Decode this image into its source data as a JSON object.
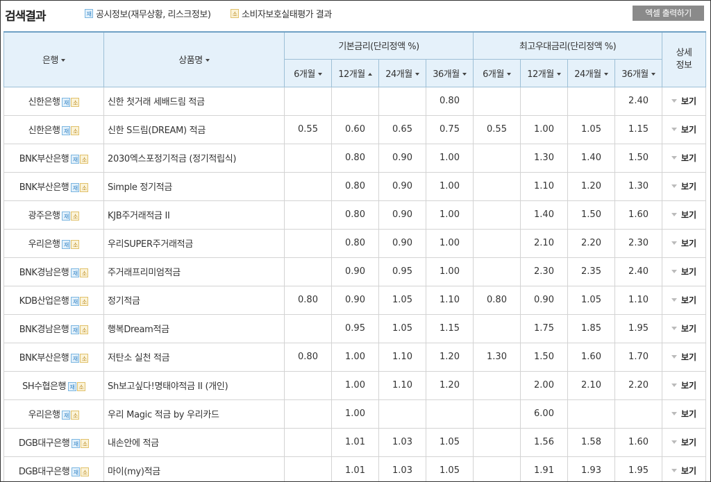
{
  "header": {
    "title": "검색결과",
    "legend_jae_badge": "재",
    "legend_jae_label": "공시정보(재무상황, 리스크정보)",
    "legend_so_badge": "소",
    "legend_so_label": "소비자보호실태평가 결과",
    "excel_button": "엑셀 출력하기"
  },
  "columns": {
    "bank": "은행",
    "product": "상품명",
    "base_group": "기본금리(단리정액 %)",
    "max_group": "최고우대금리(단리정액 %)",
    "detail": "상세정보",
    "terms": [
      "6개월",
      "12개월",
      "24개월",
      "36개월"
    ]
  },
  "badges": {
    "jae": "재",
    "so": "소"
  },
  "view_label": "보기",
  "rows": [
    {
      "bank": "신한은행",
      "product": "신한 첫거래 세배드림 적금",
      "base": [
        "",
        "",
        "",
        "0.80"
      ],
      "max": [
        "",
        "",
        "",
        "2.40"
      ]
    },
    {
      "bank": "신한은행",
      "product": "신한 S드림(DREAM) 적금",
      "base": [
        "0.55",
        "0.60",
        "0.65",
        "0.75"
      ],
      "max": [
        "0.55",
        "1.00",
        "1.05",
        "1.15"
      ]
    },
    {
      "bank": "BNK부산은행",
      "product": "2030엑스포정기적금 (정기적립식)",
      "base": [
        "",
        "0.80",
        "0.90",
        "1.00"
      ],
      "max": [
        "",
        "1.30",
        "1.40",
        "1.50"
      ]
    },
    {
      "bank": "BNK부산은행",
      "product": "Simple 정기적금",
      "base": [
        "",
        "0.80",
        "0.90",
        "1.00"
      ],
      "max": [
        "",
        "1.10",
        "1.20",
        "1.30"
      ]
    },
    {
      "bank": "광주은행",
      "product": "KJB주거래적금 II",
      "base": [
        "",
        "0.80",
        "0.90",
        "1.00"
      ],
      "max": [
        "",
        "1.40",
        "1.50",
        "1.60"
      ]
    },
    {
      "bank": "우리은행",
      "product": "우리SUPER주거래적금",
      "base": [
        "",
        "0.80",
        "0.90",
        "1.00"
      ],
      "max": [
        "",
        "2.10",
        "2.20",
        "2.30"
      ]
    },
    {
      "bank": "BNK경남은행",
      "product": "주거래프리미엄적금",
      "base": [
        "",
        "0.90",
        "0.95",
        "1.00"
      ],
      "max": [
        "",
        "2.30",
        "2.35",
        "2.40"
      ]
    },
    {
      "bank": "KDB산업은행",
      "product": "정기적금",
      "base": [
        "0.80",
        "0.90",
        "1.05",
        "1.10"
      ],
      "max": [
        "0.80",
        "0.90",
        "1.05",
        "1.10"
      ]
    },
    {
      "bank": "BNK경남은행",
      "product": "행복Dream적금",
      "base": [
        "",
        "0.95",
        "1.05",
        "1.15"
      ],
      "max": [
        "",
        "1.75",
        "1.85",
        "1.95"
      ]
    },
    {
      "bank": "BNK부산은행",
      "product": "저탄소 실천 적금",
      "base": [
        "0.80",
        "1.00",
        "1.10",
        "1.20"
      ],
      "max": [
        "1.30",
        "1.50",
        "1.60",
        "1.70"
      ]
    },
    {
      "bank": "SH수협은행",
      "product": "Sh보고싶다!명태야적금 II (개인)",
      "base": [
        "",
        "1.00",
        "1.10",
        "1.20"
      ],
      "max": [
        "",
        "2.00",
        "2.10",
        "2.20"
      ]
    },
    {
      "bank": "우리은행",
      "product": "우리 Magic 적금 by 우리카드",
      "base": [
        "",
        "1.00",
        "",
        ""
      ],
      "max": [
        "",
        "6.00",
        "",
        ""
      ]
    },
    {
      "bank": "DGB대구은행",
      "product": "내손안에 적금",
      "base": [
        "",
        "1.01",
        "1.03",
        "1.05"
      ],
      "max": [
        "",
        "1.56",
        "1.58",
        "1.60"
      ]
    },
    {
      "bank": "DGB대구은행",
      "product": "마이(my)적금",
      "base": [
        "",
        "1.01",
        "1.03",
        "1.05"
      ],
      "max": [
        "",
        "1.91",
        "1.93",
        "1.95"
      ]
    }
  ]
}
